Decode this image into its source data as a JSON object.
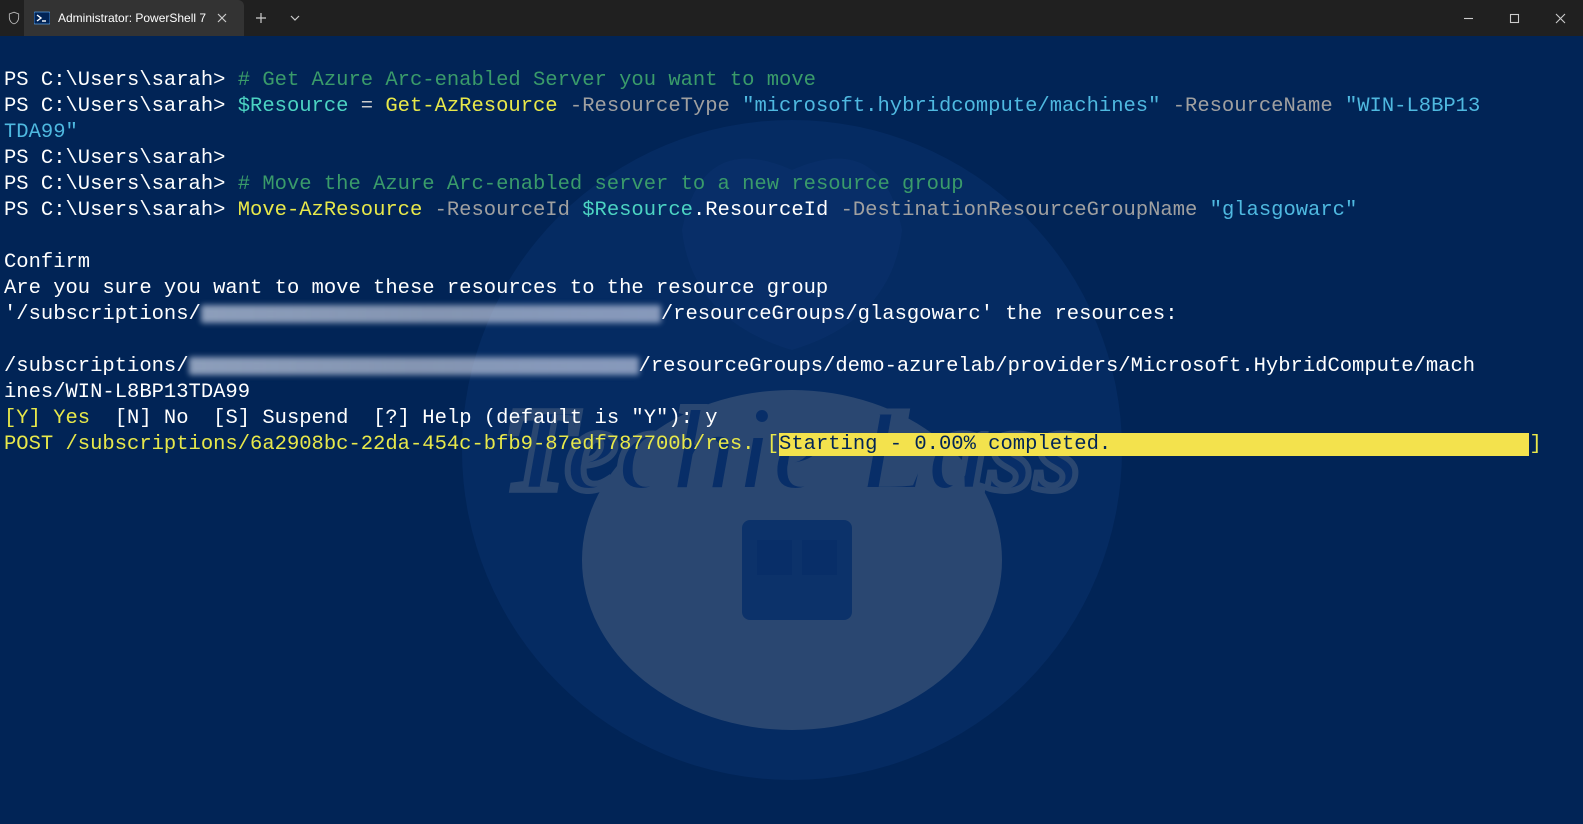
{
  "titlebar": {
    "tab_title": "Administrator: PowerShell 7"
  },
  "terminal": {
    "prompt": "PS C:\\Users\\sarah>",
    "lines": {
      "comment1": "# Get Azure Arc-enabled Server you want to move",
      "l2_var": "$Resource",
      "l2_eq": " = ",
      "l2_cmd": "Get-AzResource",
      "l2_p1": " -ResourceType ",
      "l2_s1": "\"microsoft.hybridcompute/machines\"",
      "l2_p2": " -ResourceName ",
      "l2_s2_a": "\"WIN-L8BP13",
      "l2_s2_b": "TDA99\"",
      "comment2": "# Move the Azure Arc-enabled server to a new resource group",
      "l5_cmd": "Move-AzResource",
      "l5_p1": " -ResourceId ",
      "l5_var": "$Resource",
      "l5_dot": ".ResourceId",
      "l5_p2": " -DestinationResourceGroupName ",
      "l5_s1": "\"glasgowarc\"",
      "confirm": "Confirm",
      "confirm_q": "Are you sure you want to move these resources to the resource group",
      "path1_a": "'/subscriptions/",
      "path1_b": "/resourceGroups/glasgowarc' the resources:",
      "path2_a": "/subscriptions/",
      "path2_b": "/resourceGroups/demo-azurelab/providers/Microsoft.HybridCompute/mach",
      "path2_c": "ines/WIN-L8BP13TDA99",
      "opts_y": "[Y] Yes  ",
      "opts_n": "[N] No  ",
      "opts_s": "[S] Suspend  ",
      "opts_h": "[?] Help (default is \"Y\"): ",
      "answer": "y",
      "post_a": "POST /subscriptions/6a2908bc-22da-454c-bfb9-87edf787700b/res.",
      "post_brL": " [",
      "post_msg": "Starting - 0.00% completed.",
      "post_pad": "                                  ",
      "post_brR": "]"
    }
  }
}
